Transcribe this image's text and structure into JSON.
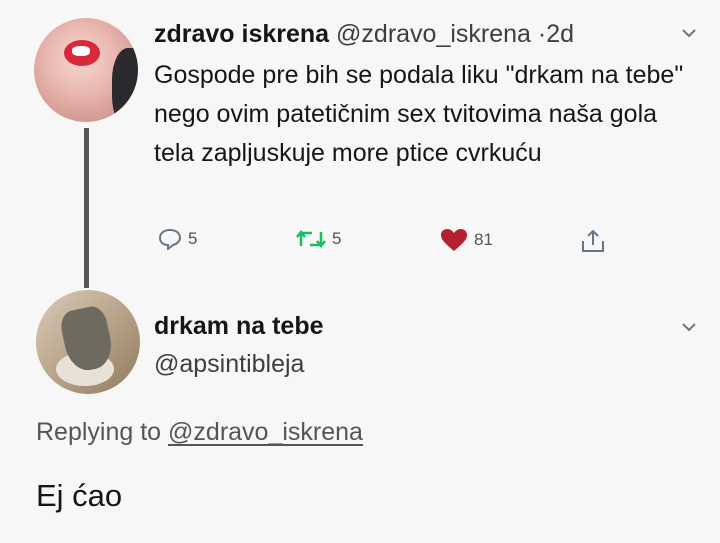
{
  "tweet1": {
    "display_name": "zdravo iskrena",
    "handle": "@zdravo_iskrena",
    "separator": "·",
    "time": "2d",
    "text": "Gospode pre bih se podala liku \"drkam na tebe\" nego ovim patetičnim sex tvitovima naša gola tela zapljuskuje more ptice cvrkuću",
    "replies": "5",
    "retweets": "5",
    "likes": "81",
    "like_color": "#b5202e"
  },
  "tweet2": {
    "display_name": "drkam na tebe",
    "handle": "@apsintibleja",
    "replying_prefix": "Replying to",
    "replying_to": "@zdravo_iskrena",
    "text": "Ej ćao"
  }
}
